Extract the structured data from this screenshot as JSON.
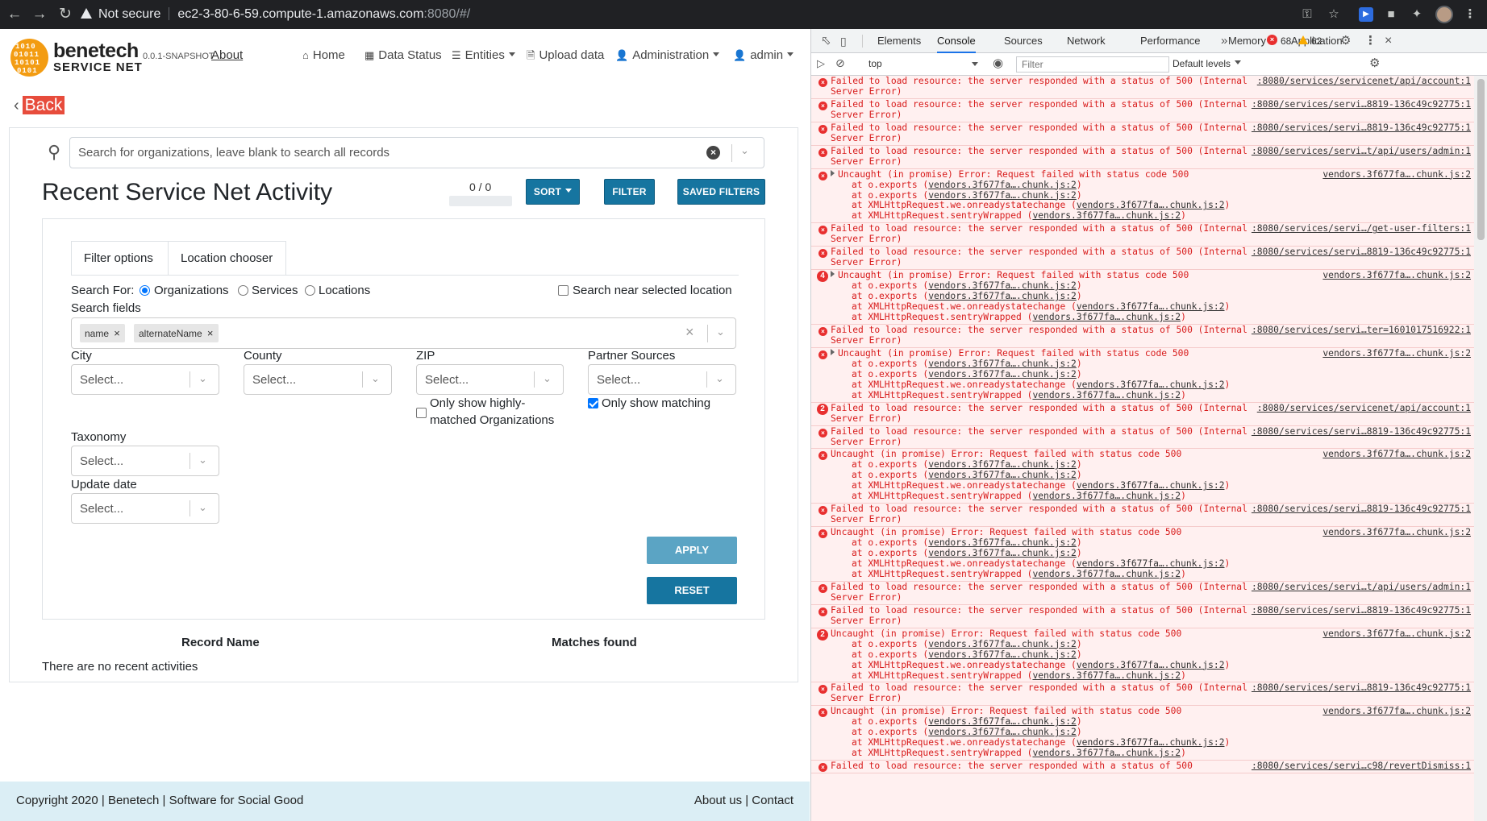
{
  "browser": {
    "security_label": "Not secure",
    "url_host": "ec2-3-80-6-59.compute-1.amazonaws.com",
    "url_rest": ":8080/#/"
  },
  "app": {
    "brand_name": "benetech",
    "brand_sub": "SERVICE NET",
    "version": "0.0.1-SNAPSHOT",
    "about": "About",
    "nav": {
      "home": "Home",
      "data_status": "Data Status",
      "entities": "Entities",
      "upload": "Upload data",
      "administration": "Administration",
      "user": "admin"
    },
    "back": "Back",
    "search_placeholder": "Search for organizations, leave blank to search all records",
    "title": "Recent Service Net Activity",
    "counter": "0 / 0",
    "sort": "SORT",
    "filter": "FILTER",
    "saved_filters": "SAVED FILTERS",
    "tabs": [
      "Filter options",
      "Location chooser"
    ],
    "search_for_label": "Search For:",
    "radios": [
      "Organizations",
      "Services",
      "Locations"
    ],
    "near_location": "Search near selected location",
    "search_fields_label": "Search fields",
    "chips": [
      "name",
      "alternateName"
    ],
    "city": "City",
    "county": "County",
    "zip": "ZIP",
    "partner_sources": "Partner Sources",
    "select_placeholder": "Select...",
    "highly_matched_1": "Only show highly-",
    "highly_matched_2": "matched Organizations",
    "only_matching": "Only show matching",
    "taxonomy": "Taxonomy",
    "update_date": "Update date",
    "apply": "APPLY",
    "reset": "RESET",
    "col_record": "Record Name",
    "col_matches": "Matches found",
    "empty": "There are no recent activities",
    "footer_left": "Copyright 2020 | Benetech | Software for Social Good",
    "footer_right": "About us | Contact"
  },
  "devtools": {
    "tabs": [
      "Elements",
      "Console",
      "Sources",
      "Network",
      "Performance",
      "Memory",
      "Application"
    ],
    "errors": "68",
    "warnings": "62",
    "context": "top",
    "filter_placeholder": "Filter",
    "levels": "Default levels",
    "colors": {
      "error_text": "#d81c1c",
      "error_bg": "#fff0f0",
      "active_tab": "#1a73e8"
    },
    "messages": [
      {
        "text": "Failed to load resource: the server responded with a status of 500 (Internal Server Error)",
        "src": ":8080/services/servicenet/api/account:1"
      },
      {
        "text": "Failed to load resource: the server responded with a status of 500 (Internal Server Error)",
        "src": ":8080/services/servi…8819-136c49c92775:1"
      },
      {
        "text": "Failed to load resource: the server responded with a status of 500 (Internal Server Error)",
        "src": ":8080/services/servi…8819-136c49c92775:1"
      },
      {
        "text": "Failed to load resource: the server responded with a status of 500 (Internal Server Error)",
        "src": ":8080/services/servi…t/api/users/admin:1"
      },
      {
        "text": "Uncaught (in promise) Error: Request failed with status code 500",
        "src": "vendors.3f677fa….chunk.js:2",
        "expand": true,
        "stack": true
      },
      {
        "text": "Failed to load resource: the server responded with a status of 500 (Internal Server Error)",
        "src": ":8080/services/servi…/get-user-filters:1"
      },
      {
        "text": "Failed to load resource: the server responded with a status of 500 (Internal Server Error)",
        "src": ":8080/services/servi…8819-136c49c92775:1"
      },
      {
        "text": "Uncaught (in promise) Error: Request failed with status code 500",
        "src": "vendors.3f677fa….chunk.js:2",
        "expand": true,
        "stack": true,
        "count": "4"
      },
      {
        "text": "Failed to load resource: the server responded with a status of 500 (Internal Server Error)",
        "src": ":8080/services/servi…ter=1601017516922:1"
      },
      {
        "text": "Uncaught (in promise) Error: Request failed with status code 500",
        "src": "vendors.3f677fa….chunk.js:2",
        "expand": true,
        "stack": true
      },
      {
        "text": "Failed to load resource: the server responded with a status of 500 (Internal Server Error)",
        "src": ":8080/services/servicenet/api/account:1",
        "count": "2"
      },
      {
        "text": "Failed to load resource: the server responded with a status of 500 (Internal Server Error)",
        "src": ":8080/services/servi…8819-136c49c92775:1"
      },
      {
        "text": "Uncaught (in promise) Error: Request failed with status code 500",
        "src": "vendors.3f677fa….chunk.js:2",
        "stack": true
      },
      {
        "text": "Failed to load resource: the server responded with a status of 500 (Internal Server Error)",
        "src": ":8080/services/servi…8819-136c49c92775:1"
      },
      {
        "text": "Uncaught (in promise) Error: Request failed with status code 500",
        "src": "vendors.3f677fa….chunk.js:2",
        "stack": true
      },
      {
        "text": "Failed to load resource: the server responded with a status of 500 (Internal Server Error)",
        "src": ":8080/services/servi…t/api/users/admin:1"
      },
      {
        "text": "Failed to load resource: the server responded with a status of 500 (Internal Server Error)",
        "src": ":8080/services/servi…8819-136c49c92775:1"
      },
      {
        "text": "Uncaught (in promise) Error: Request failed with status code 500",
        "src": "vendors.3f677fa….chunk.js:2",
        "stack": true,
        "count": "2"
      },
      {
        "text": "Failed to load resource: the server responded with a status of 500 (Internal Server Error)",
        "src": ":8080/services/servi…8819-136c49c92775:1"
      },
      {
        "text": "Uncaught (in promise) Error: Request failed with status code 500",
        "src": "vendors.3f677fa….chunk.js:2",
        "stack": true
      },
      {
        "text": "Failed to load resource: the server responded with a status of 500",
        "src": ":8080/services/servi…c98/revertDismiss:1"
      }
    ],
    "stack_lines": [
      {
        "pre": "at o.exports (",
        "file": "vendors.3f677fa….chunk.js:2",
        "post": ")"
      },
      {
        "pre": "at o.exports (",
        "file": "vendors.3f677fa….chunk.js:2",
        "post": ")"
      },
      {
        "pre": "at XMLHttpRequest.we.onreadystatechange (",
        "file": "vendors.3f677fa….chunk.js:2",
        "post": ")"
      },
      {
        "pre": "at XMLHttpRequest.sentryWrapped (",
        "file": "vendors.3f677fa….chunk.js:2",
        "post": ")"
      }
    ]
  }
}
